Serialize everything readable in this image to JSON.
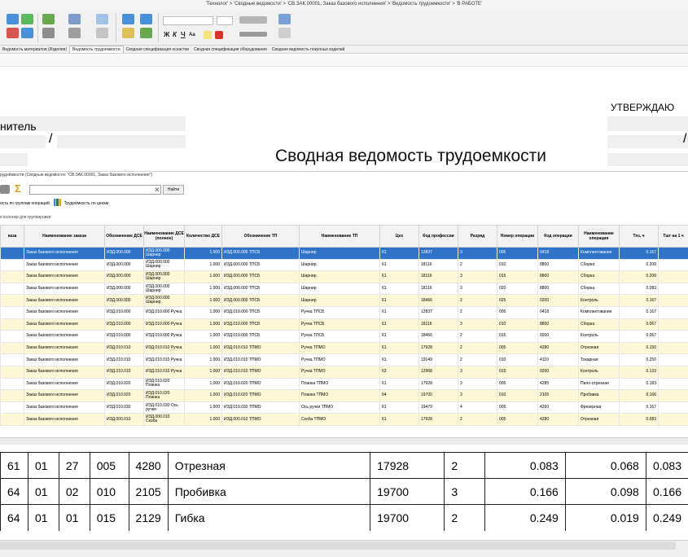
{
  "window": {
    "title": "'Технолог' > 'Сводные ведомости' > 'СВ.ЗАК.00001, Заказ базового исполнения' > 'Ведомость трудоемкости' > 'В РАБОТЕ'"
  },
  "ribbon": {
    "font_size_value": "",
    "format_labels": [
      "Ж",
      "К",
      "Ч",
      "Aa"
    ]
  },
  "tabs": [
    {
      "label": "Ведомость материалов (Изделия)",
      "active": false
    },
    {
      "label": "Ведомость трудоемкости",
      "active": true
    },
    {
      "label": "Сводная спецификация оснастки",
      "active": false
    },
    {
      "label": "Сводная спецификация оборудования",
      "active": false
    },
    {
      "label": "Сводная ведомость покупных изделий",
      "active": false
    }
  ],
  "report": {
    "approve_label": "УТВЕРЖДАЮ",
    "executor_label": "нитель",
    "slash": "/",
    "title": "Сводная ведомость трудоемкости"
  },
  "panel": {
    "caption": "рудоёмкости (Сводные ведомости: \"СВ.ЗАК.00001, Заказ базового исполнения\")",
    "search_value": "",
    "find_label": "Найти",
    "subtab_groups": "ость по группам операций",
    "subtab_workshops": "Трудоёмкость по цехам",
    "group_hint": "е колонки для группировки"
  },
  "grid": {
    "columns": [
      "каза",
      "Наименование заказа",
      "Обозначение ДСЕ",
      "Наименование ДСЕ (полное)",
      "Количество ДСЕ",
      "Обозначение ТП",
      "Наименование ТП",
      "Цех",
      "Код профессии",
      "Разряд",
      "Номер операции",
      "Код операции",
      "Наименование операции",
      "Тпз, ч",
      "Тшт на 1 ч"
    ],
    "rows": [
      [
        "",
        "Заказ базового исполнения",
        "ИЗД.000.000",
        "ИЗД.000.000 Шарнир",
        "1.000",
        "ИЗД.000.000 ТПСБ",
        "Шарнир",
        "61",
        "12837",
        "3",
        "005",
        "0418",
        "Комплектование",
        "0.167",
        ""
      ],
      [
        "",
        "Заказ базового исполнения",
        "ИЗД.000.000",
        "ИЗД.000.000 Шарнир",
        "1.000",
        "ИЗД.000.000 ТПСБ",
        "Шарнир",
        "61",
        "18116",
        "2",
        "010",
        "8800",
        "Сборка",
        "0.200",
        ""
      ],
      [
        "",
        "Заказ базового исполнения",
        "ИЗД.000.000",
        "ИЗД.000.000 Шарнир",
        "1.000",
        "ИЗД.000.000 ТПСБ",
        "Шарнир",
        "61",
        "18116",
        "3",
        "015",
        "8800",
        "Сборка",
        "0.200",
        ""
      ],
      [
        "",
        "Заказ базового исполнения",
        "ИЗД.000.000",
        "ИЗД.000.000 Шарнир",
        "1.000",
        "ИЗД.000.000 ТПСБ",
        "Шарнир",
        "61",
        "18116",
        "3",
        "020",
        "8800",
        "Сборка",
        "0.083",
        ""
      ],
      [
        "",
        "Заказ базового исполнения",
        "ИЗД.000.000",
        "ИЗД.000.000 Шарнир",
        "1.000",
        "ИЗД.000.000 ТПСБ",
        "Шарнир",
        "61",
        "18466",
        "2",
        "025",
        "0200",
        "Контроль",
        "0.167",
        ""
      ],
      [
        "",
        "Заказ базового исполнения",
        "ИЗД.010.000",
        "ИЗД.010.000 Ручка",
        "1.000",
        "ИЗД.010.000 ТПСБ",
        "Ручка ТПСБ",
        "61",
        "12837",
        "2",
        "005",
        "0418",
        "Комплектование",
        "0.167",
        ""
      ],
      [
        "",
        "Заказ базового исполнения",
        "ИЗД.010.000",
        "ИЗД.010.000 Ручка",
        "1.000",
        "ИЗД.010.000 ТПСБ",
        "Ручка ТПСБ",
        "61",
        "18116",
        "3",
        "010",
        "8800",
        "Сборка",
        "0.067",
        ""
      ],
      [
        "",
        "Заказ базового исполнения",
        "ИЗД.010.000",
        "ИЗД.010.000 Ручка",
        "1.000",
        "ИЗД.010.000 ТПСБ",
        "Ручка ТПСБ",
        "61",
        "18466",
        "2",
        "015",
        "0200",
        "Контроль",
        "0.067",
        ""
      ],
      [
        "",
        "Заказ базового исполнения",
        "ИЗД.010.010",
        "ИЗД.010.010 Ручка",
        "1.000",
        "ИЗД.010.010 ТПМО",
        "Ручка ТПМО",
        "61",
        "17928",
        "2",
        "005",
        "4280",
        "Отрезная",
        "0.150",
        ""
      ],
      [
        "",
        "Заказ базового исполнения",
        "ИЗД.010.010",
        "ИЗД.010.010 Ручка",
        "1.000",
        "ИЗД.010.010 ТПМО",
        "Ручка ТПМО",
        "61",
        "19149",
        "2",
        "010",
        "4110",
        "Токарная",
        "0.250",
        ""
      ],
      [
        "",
        "Заказ базового исполнения",
        "ИЗД.010.010",
        "ИЗД.010.010 Ручка",
        "1.000",
        "ИЗД.010.010 ТПМО",
        "Ручка ТПМО",
        "63",
        "12968",
        "3",
        "015",
        "0200",
        "Контроль",
        "0.133",
        ""
      ],
      [
        "",
        "Заказ базового исполнения",
        "ИЗД.010.020",
        "ИЗД.010.020 Планка",
        "1.000",
        "ИЗД.010.020 ТПМО",
        "Планка ТПМО",
        "61",
        "17928",
        "3",
        "005",
        "4285",
        "Пило-отрезная",
        "0.183",
        ""
      ],
      [
        "",
        "Заказ базового исполнения",
        "ИЗД.010.020",
        "ИЗД.010.020 Планка",
        "1.000",
        "ИЗД.010.020 ТПМО",
        "Планка ТПМО",
        "64",
        "19700",
        "3",
        "010",
        "2105",
        "Пробивка",
        "0.166",
        ""
      ],
      [
        "",
        "Заказ базового исполнения",
        "ИЗД.010.030",
        "ИЗД.010.030 Ось ручки",
        "1.000",
        "ИЗД.010.030 ТПМО",
        "Ось ручки ТПМО",
        "61",
        "19479",
        "4",
        "005",
        "4260",
        "Фрезерная",
        "0.167",
        ""
      ],
      [
        "",
        "Заказ базового исполнения",
        "ИЗД.000.010",
        "ИЗД.000.010 Скоба",
        "1.000",
        "ИЗД.000.010 ТПМО",
        "Скоба ТПМО",
        "61",
        "17928",
        "2",
        "005",
        "4280",
        "Отрезная",
        "0.083",
        ""
      ]
    ]
  },
  "big_table": {
    "rows": [
      [
        "61",
        "01",
        "27",
        "005",
        "4280",
        "Отрезная",
        "17928",
        "2",
        "0.083",
        "0.068",
        "0.083"
      ],
      [
        "64",
        "01",
        "02",
        "010",
        "2105",
        "Пробивка",
        "19700",
        "3",
        "0.166",
        "0.098",
        "0.166"
      ],
      [
        "64",
        "01",
        "01",
        "015",
        "2129",
        "Гибка",
        "19700",
        "2",
        "0.249",
        "0.019",
        "0.249"
      ]
    ]
  },
  "colors": {
    "accent": "#2f73c8",
    "row_alt": "#fcf7d4"
  }
}
